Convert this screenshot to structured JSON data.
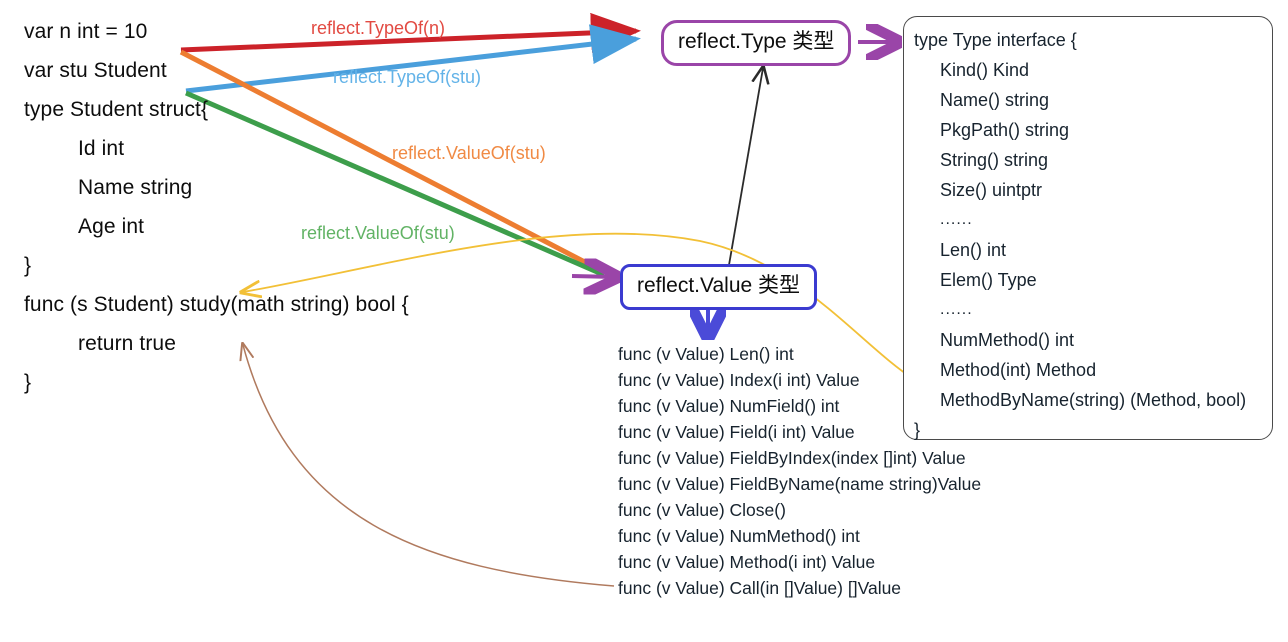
{
  "diagram": {
    "title": "Go reflect package: Type and Value relationships",
    "colors": {
      "arrow_typeof_n": "#cc2229",
      "arrow_typeof_stu": "#4a9fdc",
      "arrow_valueof_orange": "#ed7d31",
      "arrow_valueof_green": "#3d9e4b",
      "chip_type_border": "#9a45a8",
      "chip_value_border": "#3b3bd0",
      "arrow_purple": "#9a45a8",
      "arrow_black": "#2b2b2b",
      "arrow_yellow": "#f2c037",
      "arrow_brown": "#b07a5e",
      "panel_border": "#4a4a4a"
    }
  },
  "code": {
    "lines": [
      {
        "text": "var n int = 10",
        "indent": 0
      },
      {
        "text": "var stu Student",
        "indent": 0
      },
      {
        "text": "type Student struct{",
        "indent": 0
      },
      {
        "text": "Id int",
        "indent": 1
      },
      {
        "text": "Name string",
        "indent": 1
      },
      {
        "text": "Age int",
        "indent": 1
      },
      {
        "text": "}",
        "indent": 0
      },
      {
        "text": "func (s Student) study(math string) bool {",
        "indent": 0
      },
      {
        "text": "return true",
        "indent": 1
      },
      {
        "text": "}",
        "indent": 0
      }
    ]
  },
  "chips": {
    "type": "reflect.Type 类型",
    "value": "reflect.Value 类型"
  },
  "edge_labels": {
    "typeof_n": "reflect.TypeOf(n)",
    "typeof_stu": "reflect.TypeOf(stu)",
    "valueof_orange": "reflect.ValueOf(stu)",
    "valueof_green": "reflect.ValueOf(stu)"
  },
  "type_interface": {
    "lines": [
      {
        "text": "type Type interface {",
        "indent": 0,
        "dots": false
      },
      {
        "text": "Kind() Kind",
        "indent": 1,
        "dots": false
      },
      {
        "text": "Name() string",
        "indent": 1,
        "dots": false
      },
      {
        "text": "PkgPath() string",
        "indent": 1,
        "dots": false
      },
      {
        "text": "String() string",
        "indent": 1,
        "dots": false
      },
      {
        "text": "Size() uintptr",
        "indent": 1,
        "dots": false
      },
      {
        "text": "......",
        "indent": 1,
        "dots": true
      },
      {
        "text": "Len() int",
        "indent": 1,
        "dots": false
      },
      {
        "text": "Elem() Type",
        "indent": 1,
        "dots": false
      },
      {
        "text": "......",
        "indent": 1,
        "dots": true
      },
      {
        "text": "NumMethod() int",
        "indent": 1,
        "dots": false
      },
      {
        "text": "Method(int) Method",
        "indent": 1,
        "dots": false
      },
      {
        "text": "MethodByName(string) (Method, bool)",
        "indent": 1,
        "dots": false
      },
      {
        "text": "}",
        "indent": 0,
        "dots": false
      }
    ]
  },
  "value_methods": {
    "lines": [
      "func (v Value) Len() int",
      "func (v Value) Index(i int) Value",
      "func (v Value) NumField() int",
      "func (v Value) Field(i int) Value",
      "func (v Value) FieldByIndex(index []int) Value",
      "func (v Value) FieldByName(name string)Value",
      "func (v Value) Close()",
      "func (v Value) NumMethod() int",
      "func (v Value) Method(i int) Value",
      "func (v Value) Call(in []Value) []Value"
    ]
  }
}
